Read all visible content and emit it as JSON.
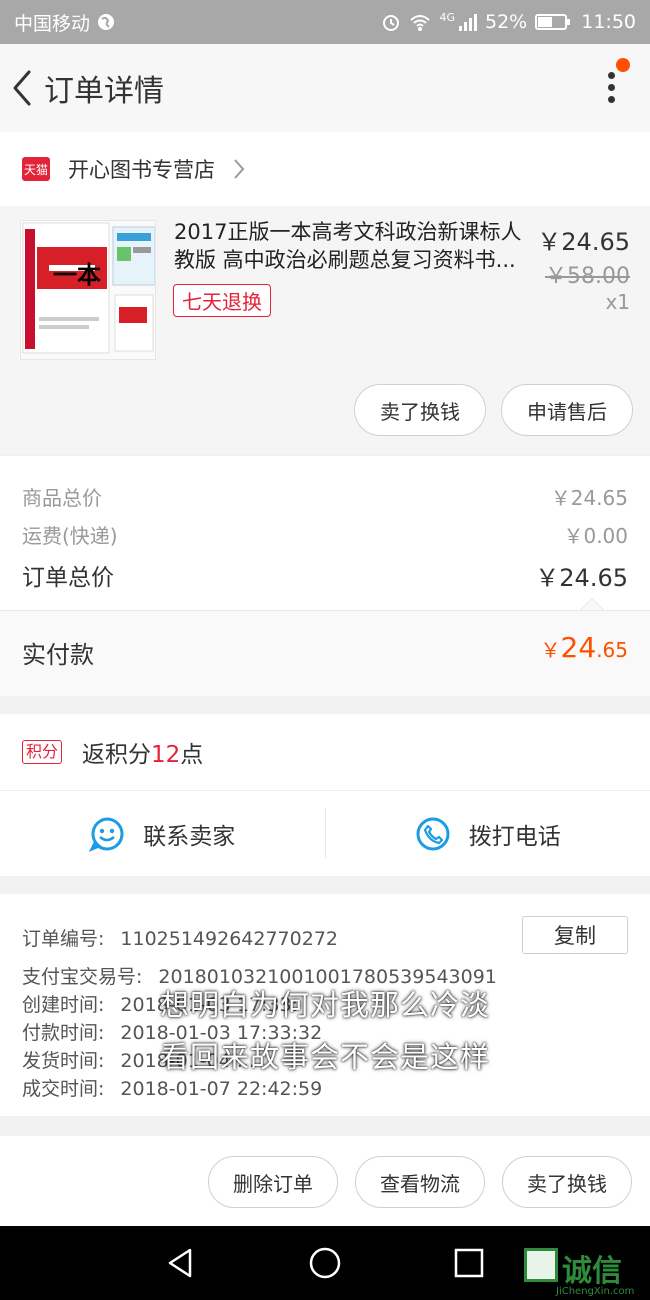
{
  "status_bar": {
    "carrier": "中国移动",
    "signal_label": "4G",
    "battery": "52%",
    "battery_level": 0.52,
    "time": "11:50"
  },
  "header": {
    "title": "订单详情"
  },
  "store": {
    "badge": "天猫",
    "name": "开心图书专营店"
  },
  "product": {
    "title": "2017正版一本高考文科政治新课标人教版 高中政治必刷题总复习资料书...",
    "return_badge": "七天退换",
    "price": "￥24.65",
    "original_price": "￥58.00",
    "quantity": "x1",
    "cover_text": "一本",
    "buttons": {
      "sell": "卖了换钱",
      "after_sale": "申请售后"
    }
  },
  "summary": {
    "goods_label": "商品总价",
    "goods_value": "￥24.65",
    "shipping_label": "运费(快递)",
    "shipping_value": "￥0.00",
    "total_label": "订单总价",
    "total_value": "￥24.65"
  },
  "paid": {
    "label": "实付款",
    "symbol": "￥",
    "int": "24",
    "dec": ".65"
  },
  "points": {
    "badge": "积分",
    "prefix": "返积分",
    "number": "12",
    "suffix": "点"
  },
  "contact": {
    "seller": "联系卖家",
    "phone": "拨打电话"
  },
  "order_info": {
    "order_no_label": "订单编号:",
    "order_no": "110251492642770272",
    "copy": "复制",
    "alipay_label": "支付宝交易号:",
    "alipay_no": "2018010321001001780539543091",
    "created_label": "创建时间:",
    "created_value": "2018-01-03 17:33:",
    "paid_label": "付款时间:",
    "paid_value": "2018-01-03 17:33:32",
    "shipped_label": "发货时间:",
    "shipped_value": "2018-01-04 ...",
    "done_label": "成交时间:",
    "done_value": "2018-01-07 22:42:59"
  },
  "subtitles": {
    "line1": "想明白为何对我那么冷淡",
    "line2": "看回来故事会不会是这样"
  },
  "actions": {
    "delete": "删除订单",
    "logistics": "查看物流",
    "sell": "卖了换钱"
  },
  "watermark": {
    "text": "诚信",
    "url": "JiChengXin.com"
  },
  "colors": {
    "accent_orange": "#ff5000",
    "tmall_red": "#e4223a",
    "blue_icon": "#1e9be6"
  }
}
